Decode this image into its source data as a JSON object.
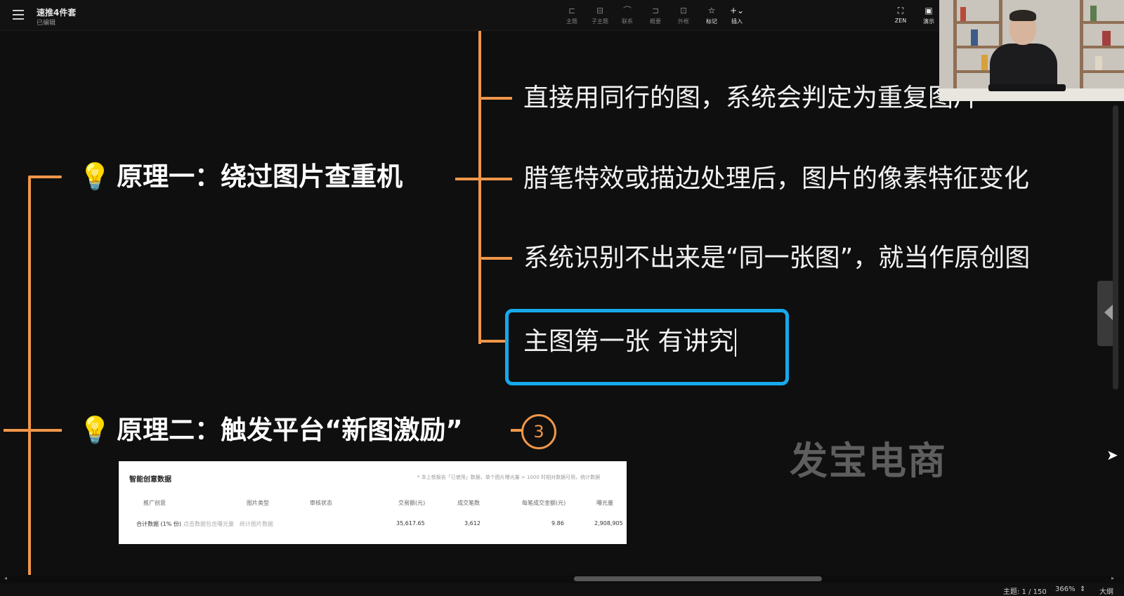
{
  "app": {
    "title": "速推4件套",
    "status": "已编辑"
  },
  "toolbar": [
    {
      "label": "主题",
      "icon": "topic-icon",
      "glyph": "⊏",
      "active": false
    },
    {
      "label": "子主题",
      "icon": "subtopic-icon",
      "glyph": "⊟",
      "active": false
    },
    {
      "label": "联系",
      "icon": "relation-icon",
      "glyph": "⌒",
      "active": false
    },
    {
      "label": "概要",
      "icon": "summary-icon",
      "glyph": "⊐",
      "active": false
    },
    {
      "label": "外框",
      "icon": "boundary-icon",
      "glyph": "⊡",
      "active": false
    },
    {
      "label": "标记",
      "icon": "star-icon",
      "glyph": "☆",
      "active": true
    },
    {
      "label": "插入",
      "icon": "plus-icon",
      "glyph": "+⌄",
      "active": true
    }
  ],
  "toolbar_right": [
    {
      "label": "ZEN",
      "icon": "fullscreen-icon",
      "glyph": "⛶"
    },
    {
      "label": "演示",
      "icon": "present-icon",
      "glyph": "▣"
    }
  ],
  "mindmap": {
    "principle1": {
      "icon": "lightbulb-icon",
      "text": "原理一：绕过图片查重机"
    },
    "principle1_children": [
      "直接用同行的图，系统会判定为重复图片",
      "腊笔特效或描边处理后，图片的像素特征变化",
      "系统识别不出来是“同一张图”，就当作原创图",
      "主图第一张 有讲究"
    ],
    "principle2": {
      "icon": "lightbulb-icon",
      "text": "原理二：触发平台“新图激励”",
      "collapsed_count": "3"
    }
  },
  "watermark": "发宝电商",
  "embedded_table": {
    "title": "智能创意数据",
    "note": "* 本上榜报告「已使用」数据，单个图片曝光量 > 1000 时相对数据可用，统计数据",
    "headers": [
      "推广创意",
      "图片类型",
      "审核状态",
      "交易额(元)",
      "成交笔数",
      "每笔成交金额(元)",
      "曝光量"
    ],
    "row": [
      "合计数据 (1% 份)",
      "点击数据包含曝光量",
      "统计图片数据",
      "35,617.65",
      "3,612",
      "9.86",
      "2,908,905"
    ]
  },
  "status_bar": {
    "topic_count": "主题: 1 / 150",
    "zoom": "366%",
    "outline": "大纲"
  }
}
